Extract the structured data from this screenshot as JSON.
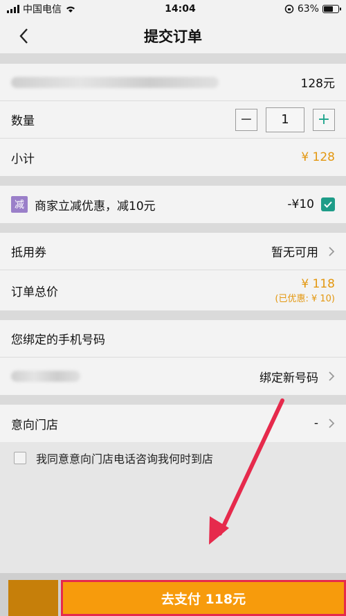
{
  "status": {
    "carrier": "中国电信",
    "time": "14:04",
    "battery": "63%"
  },
  "nav": {
    "title": "提交订单"
  },
  "product": {
    "price": "128元"
  },
  "quantity": {
    "label": "数量",
    "value": "1"
  },
  "subtotal": {
    "label": "小计",
    "value": "¥ 128"
  },
  "promo": {
    "badge": "减",
    "text": "商家立减优惠，减10元",
    "amount": "-¥10"
  },
  "coupon": {
    "label": "抵用券",
    "value": "暂无可用"
  },
  "total": {
    "label": "订单总价",
    "value": "¥ 118",
    "discount": "(已优惠: ¥ 10)"
  },
  "phone": {
    "label": "您绑定的手机号码",
    "action": "绑定新号码"
  },
  "store": {
    "label": "意向门店",
    "value": "-"
  },
  "agreement": {
    "text": "我同意意向门店电话咨询我何时到店"
  },
  "pay": {
    "label": "去支付 118元"
  },
  "colors": {
    "accent": "#f79b0c",
    "price": "#e3970f",
    "highlight": "#e62a4c",
    "check": "#1e9c88"
  }
}
